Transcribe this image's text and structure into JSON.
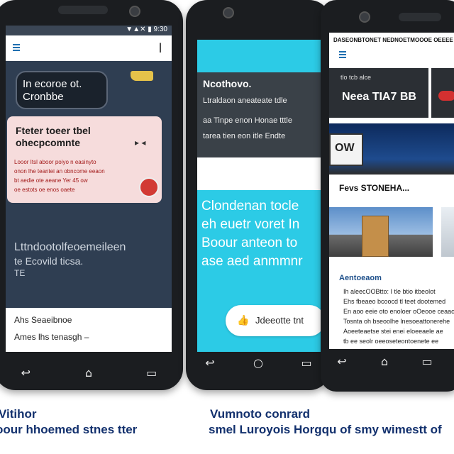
{
  "phone1": {
    "status_icons": "▼▲✕ ▮ 9:30",
    "menu_icon": "hamburger-icon",
    "top_right_text": "l",
    "pill_text": "In ecoroe ot. Cronbbe",
    "card_title": "Fteter toeer tbel ohecpcomnte",
    "card_body": [
      "Looor Itsl aboor poiyo n easinyto",
      "onon lhe teantei an obncome eeaon",
      "bt aedie ote aeane  Yer 45 ow",
      "oe estots oe enos oaete"
    ],
    "note_lines": [
      "Lttndootolfeoemeileen",
      "te Ecovild ticsa.",
      "TE"
    ],
    "footer_lines": [
      "Ahs Seaeibnoe",
      "Ames lhs tenasgh –"
    ]
  },
  "phone2": {
    "title": "Ncothovo.",
    "subtitle_lines": [
      "Ltraldaon aneateate tdle",
      "aa  Tinpe enon Honae tttle",
      "tarea tien eon itle Endte"
    ],
    "big_text_lines": [
      "Clondenan tocle",
      "eh euetr voret In",
      "Boour anteon to",
      "ase aed anmmnr"
    ],
    "button_label": "Jdeeotte tnt",
    "button_icon": "thumbs-up-icon"
  },
  "phone3": {
    "header_text": "DASEONBTONET NEDNOETMOOOE OEEEE",
    "menu_icon": "hamburger-icon",
    "dark_card_small": "tlo tcb alce",
    "dark_card_title": "Neea TIA7 BB",
    "image_badge": "OW",
    "section_title": "Fevs STONEHA...",
    "article_heading": "Aentoeaom",
    "article_lines": [
      "Ih aleecOOBtto: I tle btio itbeolot",
      "Ehs fbeaeo bcoocd tl teet dootemed",
      "En aoo eeie oto enoloer oOeooe ceaaoue",
      "Tosnta oh bseoolhe lnesoeattonerehe",
      "Aoeeteaetse stei enei eloeeaele ae",
      "tb ee seolr oeeoseteontoenete ee"
    ]
  },
  "captions": {
    "left_line1": "Vitihor",
    "left_line2": "oour hhoemed stnes tter",
    "right_line1": "Vumnoto  conrard",
    "right_line2": "smel Luroyois Horgqu of smy wimestt of"
  },
  "colors": {
    "phone1_bg": "#2f3e52",
    "phone2_accent": "#2ccbe6",
    "phone3_dark": "#2b2f34",
    "caption_blue": "#12306d",
    "card_pink": "#f6dcdc",
    "card_red_text": "#a31a1a"
  }
}
